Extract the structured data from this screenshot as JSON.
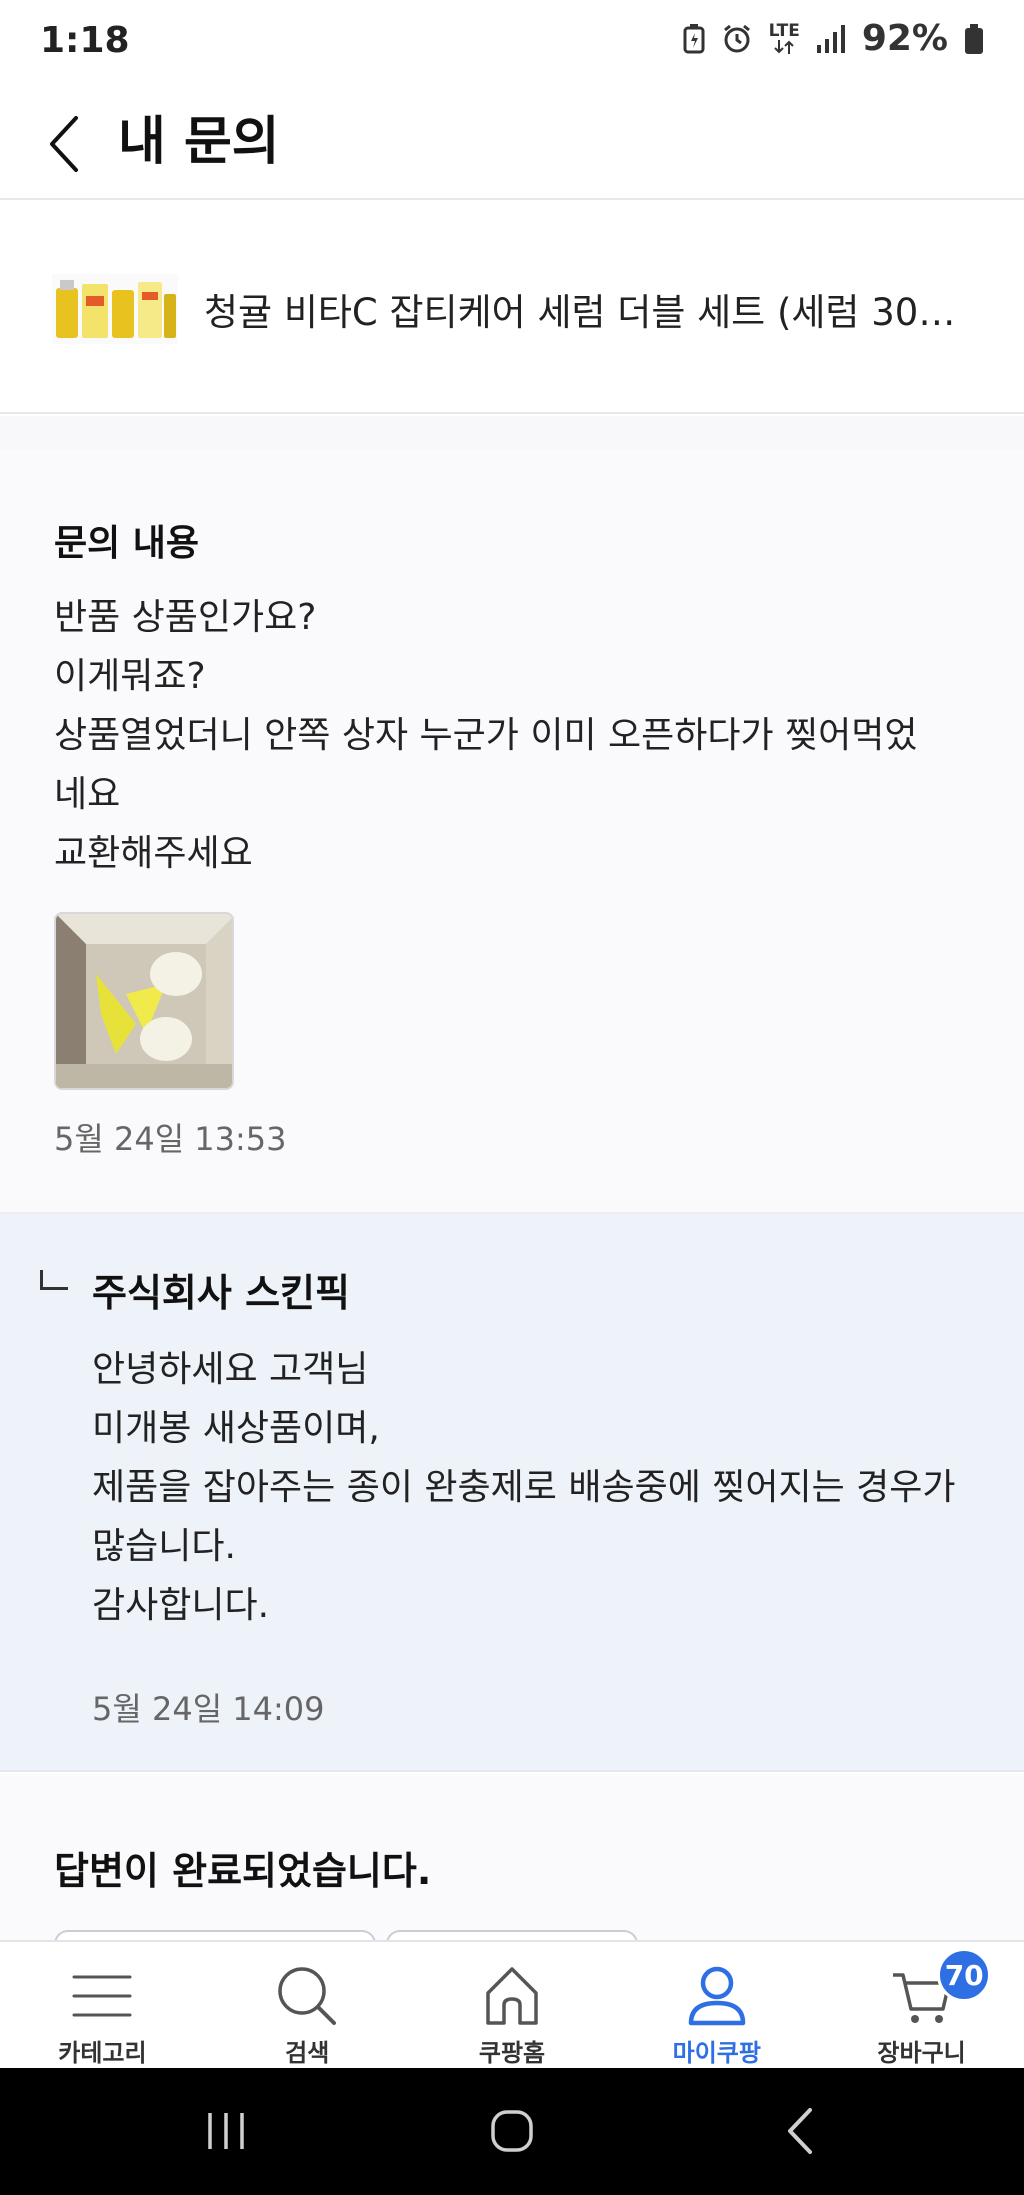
{
  "status_bar": {
    "time": "1:18",
    "network": "LTE",
    "battery": "92%"
  },
  "header": {
    "title": "내 문의",
    "back_icon": "chevron-left-icon"
  },
  "product": {
    "name": "청귤 비타C 잡티케어 세럼 더블 세트 (세럼 30m..."
  },
  "inquiry": {
    "title": "문의 내용",
    "lines": [
      "반품 상품인가요?",
      "이게뭐죠?",
      "상품열었더니 안쪽 상자 누군가 이미 오픈하다가 찢어먹었",
      "네요",
      "교환해주세요"
    ],
    "date": "5월 24일 13:53"
  },
  "answer": {
    "company": "주식회사 스킨픽",
    "lines": [
      "안녕하세요 고객님",
      "미개봉 새상품이며,",
      "제품을 잡아주는 종이 완충제로 배송중에 찢어지는 경우가",
      "많습니다.",
      "감사합니다."
    ],
    "date": "5월 24일 14:09"
  },
  "completion": {
    "text": "답변이 완료되었습니다."
  },
  "bottom_nav": {
    "items": [
      {
        "label": "카테고리",
        "icon": "menu-icon",
        "active": false
      },
      {
        "label": "검색",
        "icon": "search-icon",
        "active": false
      },
      {
        "label": "쿠팡홈",
        "icon": "home-icon",
        "active": false
      },
      {
        "label": "마이쿠팡",
        "icon": "person-icon",
        "active": true
      },
      {
        "label": "장바구니",
        "icon": "cart-icon",
        "active": false,
        "badge": "70"
      }
    ]
  },
  "colors": {
    "accent": "#2f6fe4",
    "answer_bg": "#eef2f9"
  }
}
